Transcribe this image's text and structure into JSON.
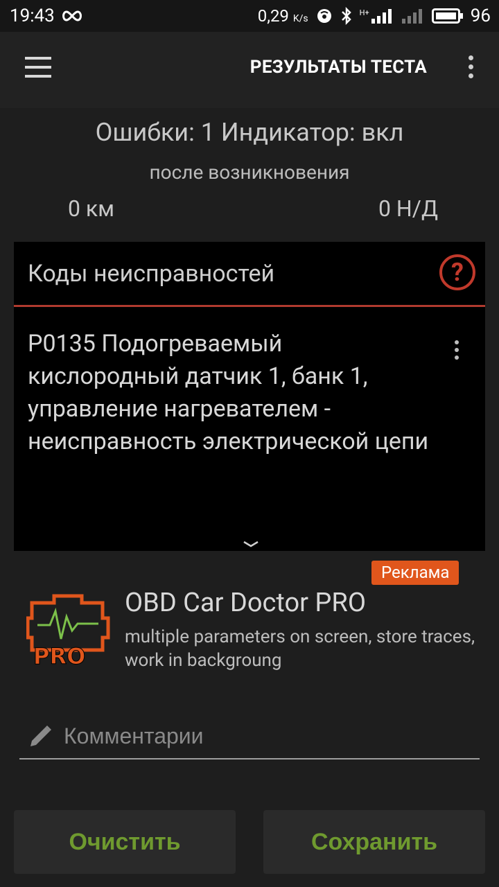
{
  "statusbar": {
    "time": "19:43",
    "speed_value": "0,29",
    "speed_unit": "K/s",
    "network": "H+",
    "battery": "96"
  },
  "appbar": {
    "title": "РЕЗУЛЬТАТЫ ТЕСТА"
  },
  "summary": {
    "errors_indicator": "Ошибки: 1 Индикатор: вкл",
    "since_label": "после возникновения",
    "distance": "0 км",
    "time_na": "0 Н/Д"
  },
  "codes": {
    "header": "Коды неисправностей",
    "items": [
      {
        "text": "P0135 Подогреваемый кислородный датчик 1, банк 1, управление нагревателем - неисправность электрической цепи"
      }
    ]
  },
  "ad": {
    "badge": "Реклама",
    "logo_text": "PRO",
    "title": "OBD Car Doctor PRO",
    "description": "multiple parameters on screen, store traces, work in backgroung"
  },
  "comment": {
    "placeholder": "Комментарии"
  },
  "buttons": {
    "clear": "Очистить",
    "save": "Сохранить"
  },
  "colors": {
    "accent_red": "#c0392b",
    "button_text": "#6f9a2f",
    "ad_badge": "#e0561c"
  }
}
